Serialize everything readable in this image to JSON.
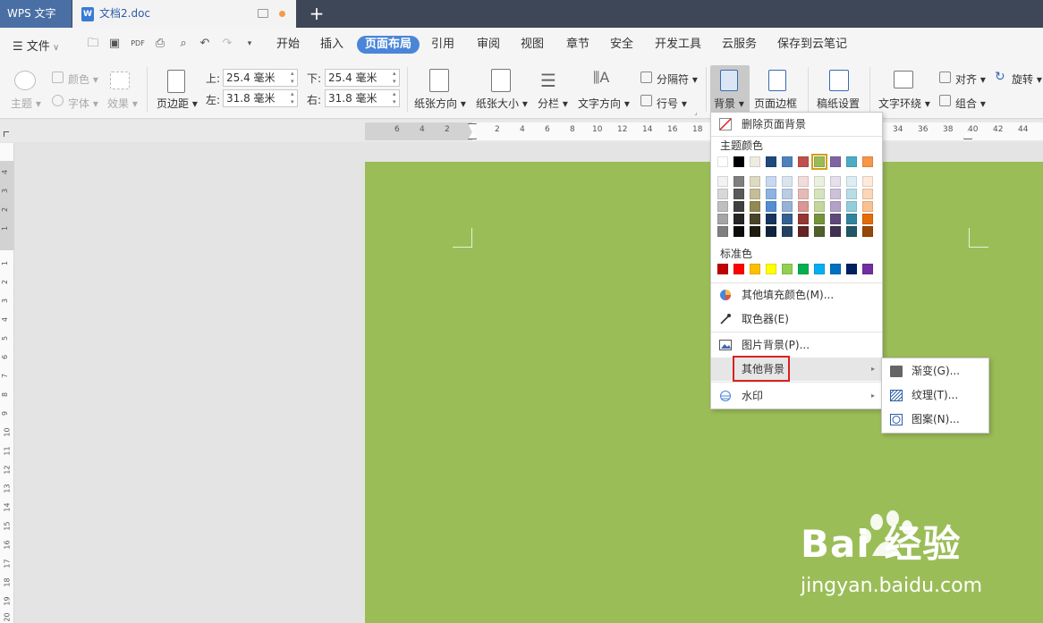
{
  "titlebar": {
    "app_name": "WPS 文字",
    "doc_tab": "文档2.doc",
    "doc_icon_letter": "W",
    "new_tab": "+"
  },
  "menubar": {
    "file": "文件",
    "tabs": [
      "开始",
      "插入",
      "页面布局",
      "引用",
      "审阅",
      "视图",
      "章节",
      "安全",
      "开发工具",
      "云服务",
      "保存到云笔记"
    ],
    "active_tab": "页面布局"
  },
  "ribbon": {
    "theme": "主题",
    "color": "颜色",
    "font": "字体",
    "effect": "效果",
    "margins": "页边距",
    "top_label": "上:",
    "top_value": "25.4 毫米",
    "bottom_label": "下:",
    "bottom_value": "25.4 毫米",
    "left_label": "左:",
    "left_value": "31.8 毫米",
    "right_label": "右:",
    "right_value": "31.8 毫米",
    "orientation": "纸张方向",
    "size": "纸张大小",
    "columns": "分栏",
    "text_direction": "文字方向",
    "breaks": "分隔符",
    "line_numbers": "行号",
    "background": "背景",
    "page_border": "页面边框",
    "paper_setup": "稿纸设置",
    "wrap_text": "文字环绕",
    "align": "对齐",
    "rotate": "旋转",
    "group": "组合"
  },
  "ruler": {
    "h_numbers": [
      "6",
      "4",
      "2",
      "2",
      "4",
      "6",
      "8",
      "10",
      "12",
      "14",
      "16",
      "18",
      "34",
      "36",
      "38",
      "40",
      "42",
      "44"
    ],
    "v_top": [
      "4",
      "3",
      "2",
      "1"
    ],
    "v_main": [
      "1",
      "2",
      "3",
      "4",
      "5",
      "6",
      "7",
      "8",
      "9",
      "10",
      "11",
      "12",
      "13",
      "14",
      "15",
      "16",
      "17",
      "18",
      "19",
      "20"
    ]
  },
  "background_menu": {
    "delete": "删除页面背景",
    "theme_colors_label": "主题颜色",
    "standard_colors_label": "标准色",
    "more_fill": "其他填充颜色(M)...",
    "eyedropper": "取色器(E)",
    "picture_bg": "图片背景(P)...",
    "other_bg": "其他背景",
    "watermark": "水印",
    "theme_top_row": [
      "#ffffff",
      "#000000",
      "#eeece1",
      "#1f497d",
      "#4f81bd",
      "#c0504d",
      "#9bbb59",
      "#8064a2",
      "#4bacc6",
      "#f79646"
    ],
    "theme_shades": [
      [
        "#f2f2f2",
        "#7f7f7f",
        "#ddd9c3",
        "#c6d9f0",
        "#dbe5f1",
        "#f2dcdb",
        "#ebf1dd",
        "#e5e0ec",
        "#dbeef3",
        "#fdeada"
      ],
      [
        "#d8d8d8",
        "#595959",
        "#c4bd97",
        "#8db3e2",
        "#b8cce4",
        "#e5b9b7",
        "#d7e3bc",
        "#ccc1d9",
        "#b7dde8",
        "#fbd5b5"
      ],
      [
        "#bfbfbf",
        "#3f3f3f",
        "#938953",
        "#548dd4",
        "#95b3d7",
        "#d99694",
        "#c3d69b",
        "#b2a2c7",
        "#92cddc",
        "#fac08f"
      ],
      [
        "#a5a5a5",
        "#262626",
        "#494429",
        "#17365d",
        "#366092",
        "#953734",
        "#76923c",
        "#5f497a",
        "#31859b",
        "#e36c09"
      ],
      [
        "#7f7f7f",
        "#0c0c0c",
        "#1d1b10",
        "#0f243e",
        "#244061",
        "#632423",
        "#4f6128",
        "#3f3151",
        "#205867",
        "#974806"
      ]
    ],
    "standard_colors": [
      "#c00000",
      "#ff0000",
      "#ffc000",
      "#ffff00",
      "#92d050",
      "#00b050",
      "#00b0f0",
      "#0070c0",
      "#002060",
      "#7030a0"
    ],
    "selected_color": "#9bbb59"
  },
  "submenu": {
    "gradient": "渐变(G)...",
    "texture": "纹理(T)...",
    "pattern": "图案(N)..."
  },
  "page": {
    "background_color": "#9bbd57"
  },
  "watermark": {
    "brand": "Bai  经验",
    "url": "jingyan.baidu.com"
  }
}
